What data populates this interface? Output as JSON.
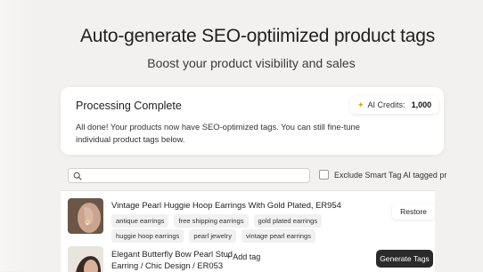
{
  "header": {
    "title": "Auto-generate SEO-optiimized product tags",
    "subtitle": "Boost your product visibility and sales"
  },
  "status_card": {
    "title": "Processing Complete",
    "message": "All done! Your products now have SEO-optimized tags. You can still fine-tune individual product tags below.",
    "credits_label": "AI Credits:",
    "credits_value": "1,000",
    "credits_icon": "sparkle-icon",
    "accent": "#d6a21e"
  },
  "filters": {
    "search_value": "",
    "search_icon": "search-icon",
    "exclude_label": "Exclude Smart Tag AI tagged pr",
    "exclude_checked": false
  },
  "products": [
    {
      "title": "Vintage Pearl Huggie Hoop Earrings With Gold Plated, ER954",
      "tags": [
        "antique earrings",
        "free shipping earrings",
        "gold plated earrings",
        "huggie hoop earrings",
        "pearl jewelry",
        "vintage pearl earrings"
      ],
      "action_label": "Restore"
    },
    {
      "title_line1": "Elegant Butterfly Bow Pearl Stud",
      "title_line2": "Earring / Chic Design / ER053",
      "add_tag_label": "+ Add tag",
      "action_label": "Generate Tags"
    }
  ],
  "colors": {
    "background": "#f2f1ef",
    "card": "#ffffff",
    "primary_button": "#2a2a2a"
  }
}
